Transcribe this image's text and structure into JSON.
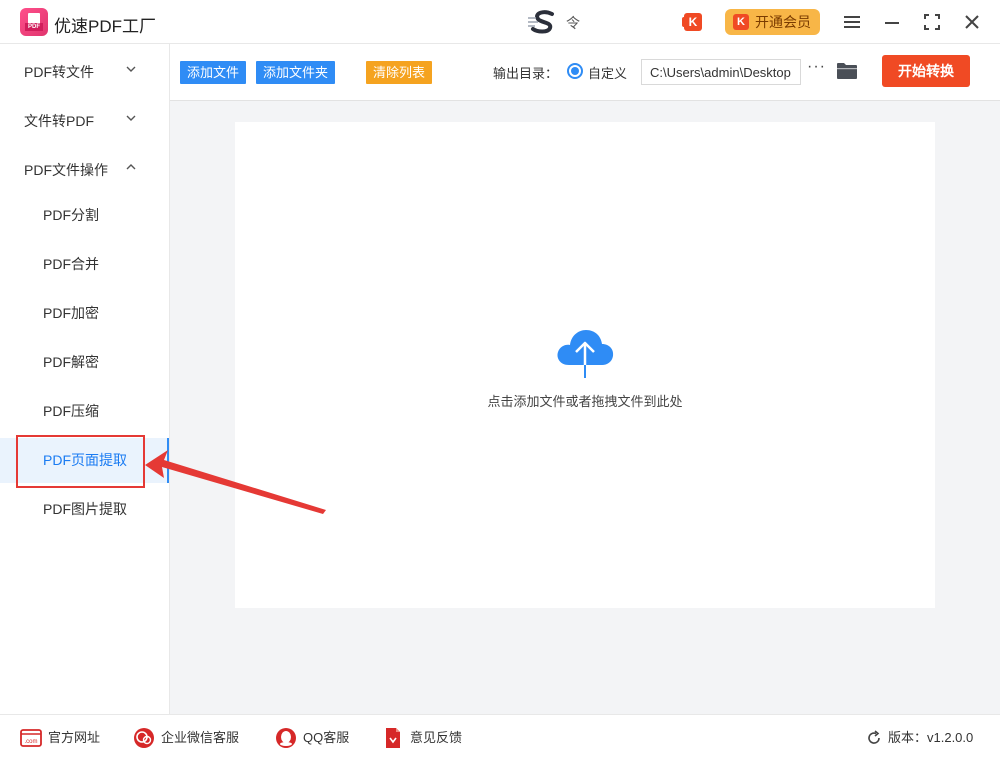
{
  "app": {
    "title": "优速PDF工厂"
  },
  "header": {
    "center_text": "令",
    "vip_label": "开通会员",
    "vip_icon": "K",
    "k_icon": "K"
  },
  "sidebar": {
    "groups": [
      {
        "label": "PDF转文件"
      },
      {
        "label": "文件转PDF"
      },
      {
        "label": "PDF文件操作"
      }
    ],
    "items": [
      {
        "label": "PDF分割"
      },
      {
        "label": "PDF合并"
      },
      {
        "label": "PDF加密"
      },
      {
        "label": "PDF解密"
      },
      {
        "label": "PDF压缩"
      },
      {
        "label": "PDF页面提取"
      },
      {
        "label": "PDF图片提取"
      }
    ]
  },
  "toolbar": {
    "add_file": "添加文件",
    "add_folder": "添加文件夹",
    "clear_list": "清除列表",
    "output_label": "输出目录：",
    "custom_label": "自定义",
    "output_path": "C:\\Users\\admin\\Desktop",
    "more": "···",
    "start": "开始转换"
  },
  "main": {
    "drop_text": "点击添加文件或者拖拽文件到此处"
  },
  "footer": {
    "website": "官方网址",
    "wechat": "企业微信客服",
    "qq": "QQ客服",
    "feedback": "意见反馈",
    "version": "版本：v1.2.0.0",
    "com_label": ".com"
  },
  "colors": {
    "accent_blue": "#2f8cf5",
    "accent_orange": "#f5a320",
    "start_red": "#f04a24",
    "vip_yellow": "#f8b647",
    "annotation_red": "#e53935"
  }
}
